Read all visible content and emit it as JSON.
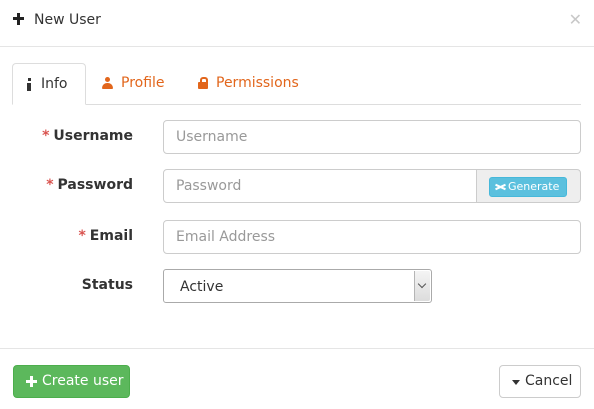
{
  "dialog": {
    "title": "New User"
  },
  "tabs": [
    {
      "label": "Info",
      "icon": "info-icon",
      "active": true
    },
    {
      "label": "Profile",
      "icon": "user-icon",
      "active": false
    },
    {
      "label": "Permissions",
      "icon": "lock-icon",
      "active": false
    }
  ],
  "form": {
    "required_marker": "*",
    "username": {
      "label": "Username",
      "placeholder": "Username",
      "value": ""
    },
    "password": {
      "label": "Password",
      "placeholder": "Password",
      "value": "",
      "generate_label": "Generate"
    },
    "email": {
      "label": "Email",
      "placeholder": "Email Address",
      "value": ""
    },
    "status": {
      "label": "Status",
      "value": "Active"
    }
  },
  "footer": {
    "create_label": "Create user",
    "cancel_label": "Cancel"
  },
  "colors": {
    "accent_tab": "#e2661c",
    "required": "#d9534f",
    "success": "#5cb85c",
    "info": "#5bc0de"
  }
}
